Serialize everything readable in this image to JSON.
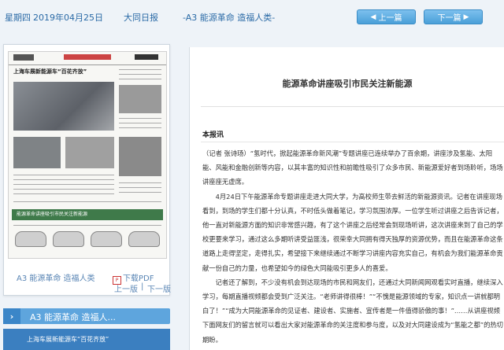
{
  "header": {
    "weekday": "星期四",
    "date": "2019年04月25日",
    "paper": "大同日报",
    "section": "-A3 能源革命 造福人类-",
    "prev_button": "上一篇",
    "next_button": "下一篇"
  },
  "thumbnail": {
    "headline": "上海车展新能源车“百花齐放”",
    "green_strip": "能源革命讲座吸引市民关注新能源",
    "page_label": "A3 能源革命 造福人类",
    "download_pdf": "下载PDF",
    "prev_page": "上一版",
    "next_page": "下一版",
    "separator": "|"
  },
  "sidebar": {
    "section_title": "A3  能源革命 造福人...",
    "items": [
      {
        "label": "上海车展新能源车“百花齐放”"
      }
    ]
  },
  "article": {
    "title": "能源革命讲座吸引市民关注新能源",
    "subtitle": "本报讯",
    "paragraphs": [
      "（记者 张诗玚）“氢时代，掀起能源革命新风潮”专题讲座已连续举办了百余期，讲座涉及氢能、太阳能、风能和金融创新等内容，以其丰富的知识性和前瞻性吸引了众多市民、新能源爱好者到场聆听，场场讲座座无虚席。",
      "4月24日下午能源革命专题讲座走进大同大学，为高校师生带去鲜活的新能源资讯。记者在讲座现场看到，到场的学生们都十分认真，不时低头做着笔记，学习氛围浓厚。一位学生听过讲座之后告诉记者，他一直对新能源方面的知识非常感兴趣，有了这个讲座之后经常会到现场听讲，这次讲座来到了自己的学校更要来学习，通过这么多期听讲受益匪浅，很荣幸大同拥有得天独厚的资源优势，而且在能源革命这条道路上走得坚定，走得扎实，希望接下来继续通过不断学习讲座内容充实自己，有机会为我们能源革命贡献一份自己的力量，也希望如今的绿色大同能吸引更多人的喜爱。",
      "记者还了解到，不少没有机会到达现场的市民和网友们，还通过大同新闻网观看实时直播，继续深入学习，每期直播视频都会受到广泛关注。“老师讲得很棒！”“不愧是能源领域的专家，知识点一讲就都明白了！”“成为大同能源革命的见证者、建设者、实施者、宣传者是一件值得骄傲的事！”……从讲座视频下面网友们的留言就可以看出大家对能源革命的关注度和参与度，以及对大同建设成为“氢能之都”的热切期盼。"
    ]
  }
}
